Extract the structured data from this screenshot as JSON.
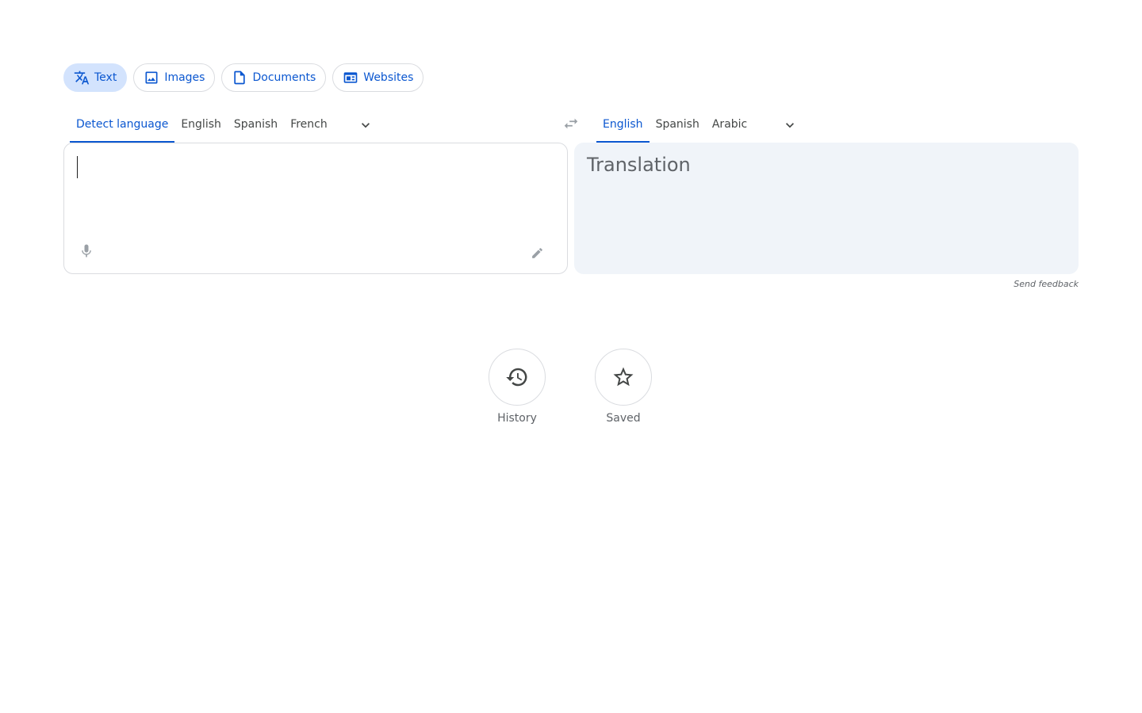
{
  "modes": [
    {
      "label": "Text",
      "icon": "translate-icon",
      "active": true
    },
    {
      "label": "Images",
      "icon": "image-icon",
      "active": false
    },
    {
      "label": "Documents",
      "icon": "document-icon",
      "active": false
    },
    {
      "label": "Websites",
      "icon": "website-icon",
      "active": false
    }
  ],
  "source_languages": [
    "Detect language",
    "English",
    "Spanish",
    "French"
  ],
  "source_selected": "Detect language",
  "target_languages": [
    "English",
    "Spanish",
    "Arabic"
  ],
  "target_selected": "English",
  "source_input": {
    "value": "",
    "placeholder": ""
  },
  "translation_placeholder": "Translation",
  "feedback_label": "Send feedback",
  "actions": {
    "history_label": "History",
    "saved_label": "Saved"
  },
  "colors": {
    "accent": "#0b57d0",
    "chip_active_bg": "#d3e3fd",
    "target_bg": "#f0f4f9"
  }
}
